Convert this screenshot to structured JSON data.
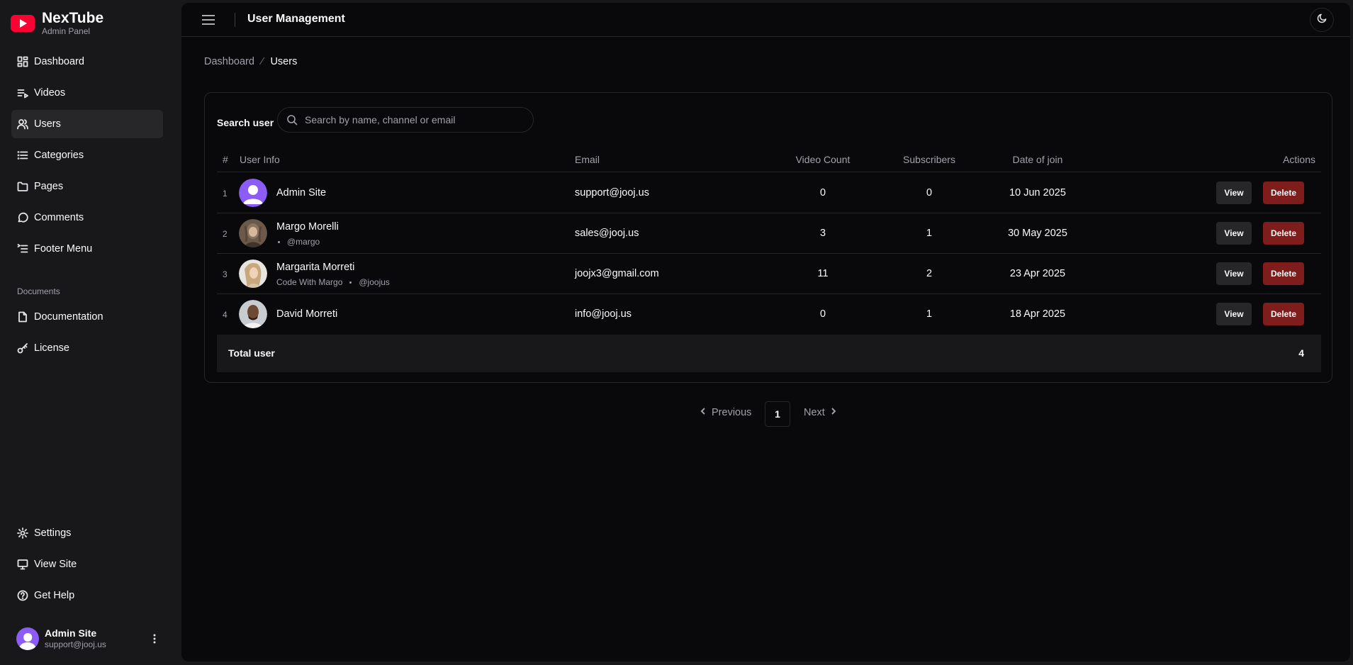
{
  "brand": {
    "title": "NexTube",
    "subtitle": "Admin Panel"
  },
  "nav": {
    "items": [
      {
        "label": "Dashboard",
        "icon": "dashboard-icon"
      },
      {
        "label": "Videos",
        "icon": "video-list-icon"
      },
      {
        "label": "Users",
        "icon": "users-icon",
        "active": true
      },
      {
        "label": "Categories",
        "icon": "list-icon"
      },
      {
        "label": "Pages",
        "icon": "folder-icon"
      },
      {
        "label": "Comments",
        "icon": "comment-icon"
      },
      {
        "label": "Footer Menu",
        "icon": "menu-list-icon"
      }
    ],
    "section_label": "Documents",
    "doc_items": [
      {
        "label": "Documentation",
        "icon": "file-icon"
      },
      {
        "label": "License",
        "icon": "key-icon"
      }
    ],
    "bottom_items": [
      {
        "label": "Settings",
        "icon": "gear-icon"
      },
      {
        "label": "View Site",
        "icon": "monitor-icon"
      },
      {
        "label": "Get Help",
        "icon": "help-icon"
      }
    ]
  },
  "current_user": {
    "name": "Admin Site",
    "email": "support@jooj.us"
  },
  "header": {
    "title": "User Management"
  },
  "breadcrumb": {
    "parent": "Dashboard",
    "current": "Users"
  },
  "search": {
    "label": "Search user",
    "placeholder": "Search by name, channel or email",
    "value": ""
  },
  "table": {
    "columns": {
      "num": "#",
      "user_info": "User Info",
      "email": "Email",
      "video_count": "Video Count",
      "subscribers": "Subscribers",
      "date": "Date of join",
      "actions": "Actions"
    },
    "view_label": "View",
    "delete_label": "Delete",
    "rows": [
      {
        "num": "1",
        "name": "Admin Site",
        "channel": "",
        "handle": "",
        "email": "support@jooj.us",
        "video_count": "0",
        "subscribers": "0",
        "date": "10 Jun 2025"
      },
      {
        "num": "2",
        "name": "Margo Morelli",
        "channel": "",
        "handle": "@margo",
        "email": "sales@jooj.us",
        "video_count": "3",
        "subscribers": "1",
        "date": "30 May 2025"
      },
      {
        "num": "3",
        "name": "Margarita Morreti",
        "channel": "Code With Margo",
        "handle": "@joojus",
        "email": "joojx3@gmail.com",
        "video_count": "11",
        "subscribers": "2",
        "date": "23 Apr 2025"
      },
      {
        "num": "4",
        "name": "David Morreti",
        "channel": "",
        "handle": "",
        "email": "info@jooj.us",
        "video_count": "0",
        "subscribers": "1",
        "date": "18 Apr 2025"
      }
    ],
    "total_label": "Total user",
    "total_value": "4"
  },
  "pagination": {
    "prev": "Previous",
    "current": "1",
    "next": "Next"
  },
  "colors": {
    "brand_red": "#ff0033",
    "delete_red": "#7f1d1d",
    "avatar_purple": "#8b5cf6"
  }
}
